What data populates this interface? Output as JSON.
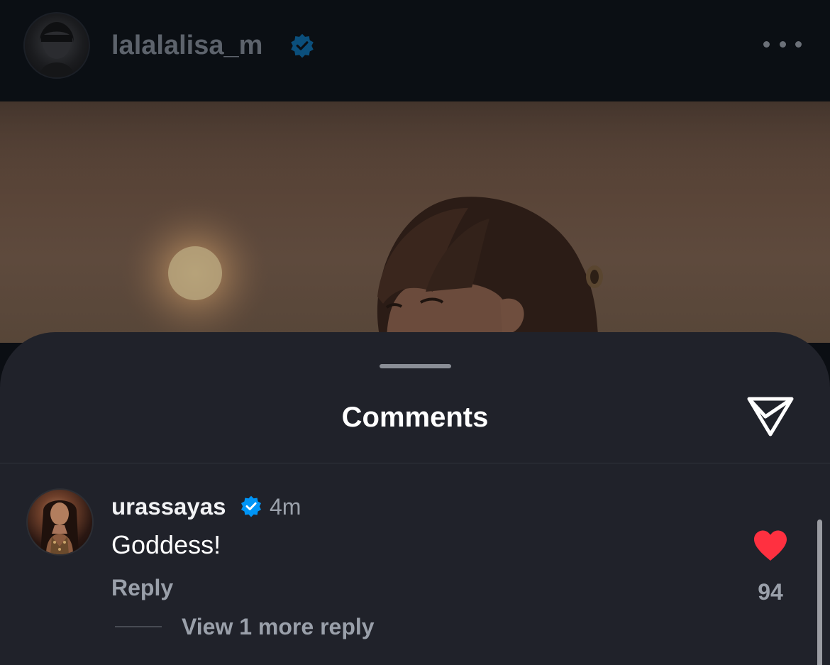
{
  "post": {
    "username": "lalalalisa_m",
    "verified": true,
    "more_icon": "more-horizontal-icon"
  },
  "comments_sheet": {
    "title": "Comments",
    "share_icon": "paper-plane-icon"
  },
  "comment": {
    "username": "urassayas",
    "verified": true,
    "time": "4m",
    "text": "Goddess!",
    "reply_label": "Reply",
    "view_replies_label": "View 1 more reply",
    "liked": true,
    "like_count": "94"
  },
  "colors": {
    "sheet_bg": "#20222a",
    "verified_blue": "#0095f6",
    "like_red": "#ff3040",
    "secondary_text": "#9aa0aa"
  }
}
